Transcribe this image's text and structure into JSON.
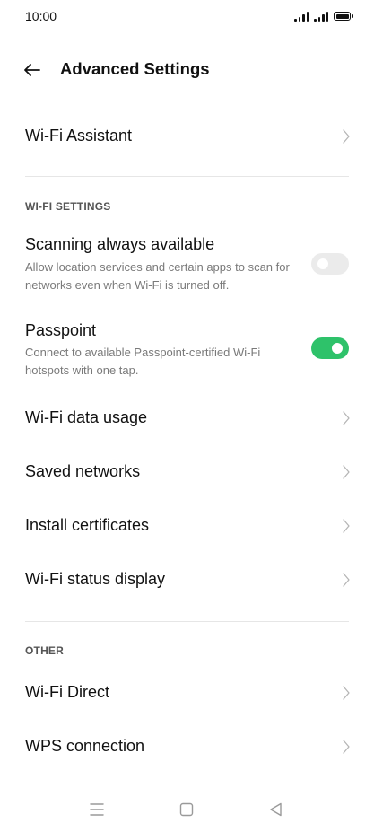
{
  "status_bar": {
    "time": "10:00",
    "icons": [
      "signal-icon",
      "signal-icon",
      "battery-icon"
    ]
  },
  "header": {
    "back_icon": "arrow-left-icon",
    "title": "Advanced Settings"
  },
  "wifi_assistant": {
    "title": "Wi-Fi Assistant",
    "icon": "chevron-right-icon"
  },
  "wifi_settings": {
    "label": "WI-FI SETTINGS",
    "scanning": {
      "title": "Scanning always available",
      "subtitle": "Allow location services and certain apps to scan for networks even when Wi-Fi is turned off.",
      "enabled": false
    },
    "passpoint": {
      "title": "Passpoint",
      "subtitle": "Connect to available Passpoint-certified Wi-Fi hotspots with one tap.",
      "enabled": true
    },
    "items": [
      {
        "title": "Wi-Fi data usage"
      },
      {
        "title": "Saved networks"
      },
      {
        "title": "Install certificates"
      },
      {
        "title": "Wi-Fi status display"
      }
    ]
  },
  "other": {
    "label": "OTHER",
    "items": [
      {
        "title": "Wi-Fi Direct"
      },
      {
        "title": "WPS connection"
      }
    ]
  },
  "nav_bar": {
    "icons": [
      "menu-icon",
      "home-icon",
      "back-triangle-icon"
    ]
  },
  "colors": {
    "toggle_on": "#2ec26a",
    "toggle_off": "#ebebeb",
    "text_primary": "#111111",
    "text_secondary": "#7a7a7a"
  }
}
